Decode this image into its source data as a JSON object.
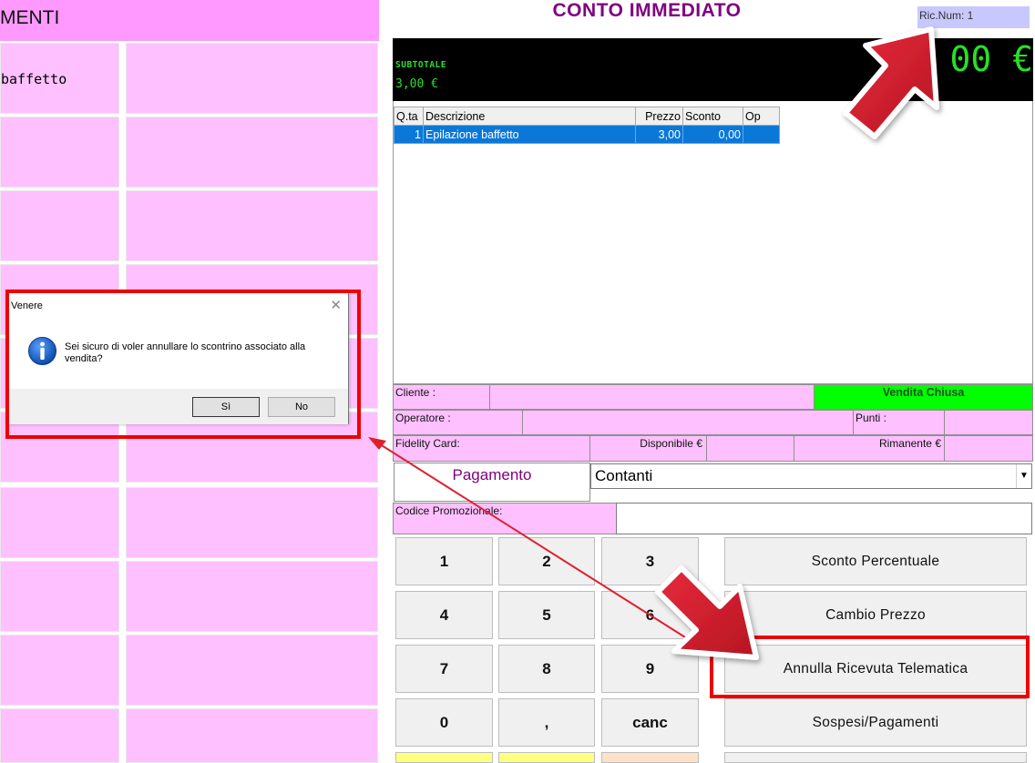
{
  "left_panel": {
    "header": "MENTI",
    "tiles": [
      {
        "label": "baffetto"
      }
    ]
  },
  "receipt": {
    "title": "CONTO IMMEDIATO",
    "ric_num": "Ric.Num: 1",
    "subtotal_label": "SUBTOTALE",
    "subtotal_value": "3,00 €",
    "big_total": "00 €",
    "columns": [
      "Q.ta",
      "Descrizione",
      "Prezzo",
      "Sconto",
      "Op"
    ],
    "rows": [
      {
        "qty": "1",
        "desc": "Epilazione baffetto",
        "price": "3,00",
        "discount": "0,00",
        "op": ""
      }
    ]
  },
  "info": {
    "cliente_label": "Cliente :",
    "status": "Vendita Chiusa",
    "operatore_label": "Operatore :",
    "punti_label": "Punti :",
    "fidelity_label": "Fidelity Card:",
    "disponibile_label": "Disponibile €",
    "rimanente_label": "Rimanente €"
  },
  "payment": {
    "label": "Pagamento",
    "selected": "Contanti",
    "promo_label": "Codice Promozionale:",
    "promo_value": ""
  },
  "keypad": {
    "k1": "1",
    "k2": "2",
    "k3": "3",
    "k4": "4",
    "k5": "5",
    "k6": "6",
    "k7": "7",
    "k8": "8",
    "k9": "9",
    "k0": "0",
    "kcomma": ",",
    "kcanc": "canc"
  },
  "functions": {
    "sconto": "Sconto Percentuale",
    "cambio": "Cambio Prezzo",
    "annulla": "Annulla Ricevuta Telematica",
    "sospesi": "Sospesi/Pagamenti"
  },
  "dialog": {
    "title": "Venere",
    "message": "Sei sicuro di voler annullare lo scontrino associato alla vendita?",
    "yes": "Sì",
    "no": "No"
  },
  "colors": {
    "tile_pink": "#ffc0ff",
    "header_pink": "#ff99ff",
    "title_purple": "#800080",
    "lcd_green": "#28e028",
    "status_green": "#00ff00",
    "selection_blue": "#0b78d7",
    "annotation_red": "#ee0000"
  }
}
